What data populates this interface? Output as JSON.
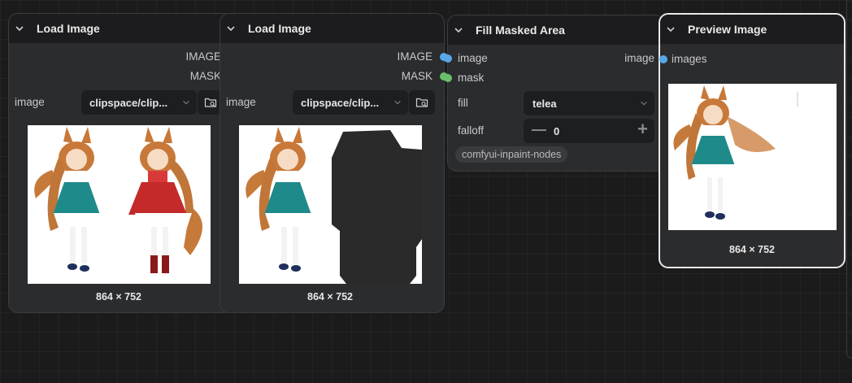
{
  "nodes": {
    "load_image_1": {
      "title": "Load Image",
      "outputs": [
        "IMAGE",
        "MASK"
      ],
      "widget_label": "image",
      "widget_value": "clipspace/clip...",
      "dims": "864 × 752"
    },
    "load_image_2": {
      "title": "Load Image",
      "outputs": [
        "IMAGE",
        "MASK"
      ],
      "widget_label": "image",
      "widget_value": "clipspace/clip...",
      "dims": "864 × 752"
    },
    "fill_masked_area": {
      "title": "Fill Masked Area",
      "inputs": [
        "image",
        "mask"
      ],
      "output": "image",
      "fill_label": "fill",
      "fill_value": "telea",
      "falloff_label": "falloff",
      "falloff_value": "0",
      "package_tag": "comfyui-inpaint-nodes"
    },
    "preview_image": {
      "title": "Preview Image",
      "input": "images",
      "dims": "864 × 752"
    }
  },
  "colors": {
    "image_slot": "#58a8e8",
    "mask_slot": "#6bbf6b",
    "node_bg": "#2b2c2e",
    "header_bg": "#1c1c1e"
  }
}
